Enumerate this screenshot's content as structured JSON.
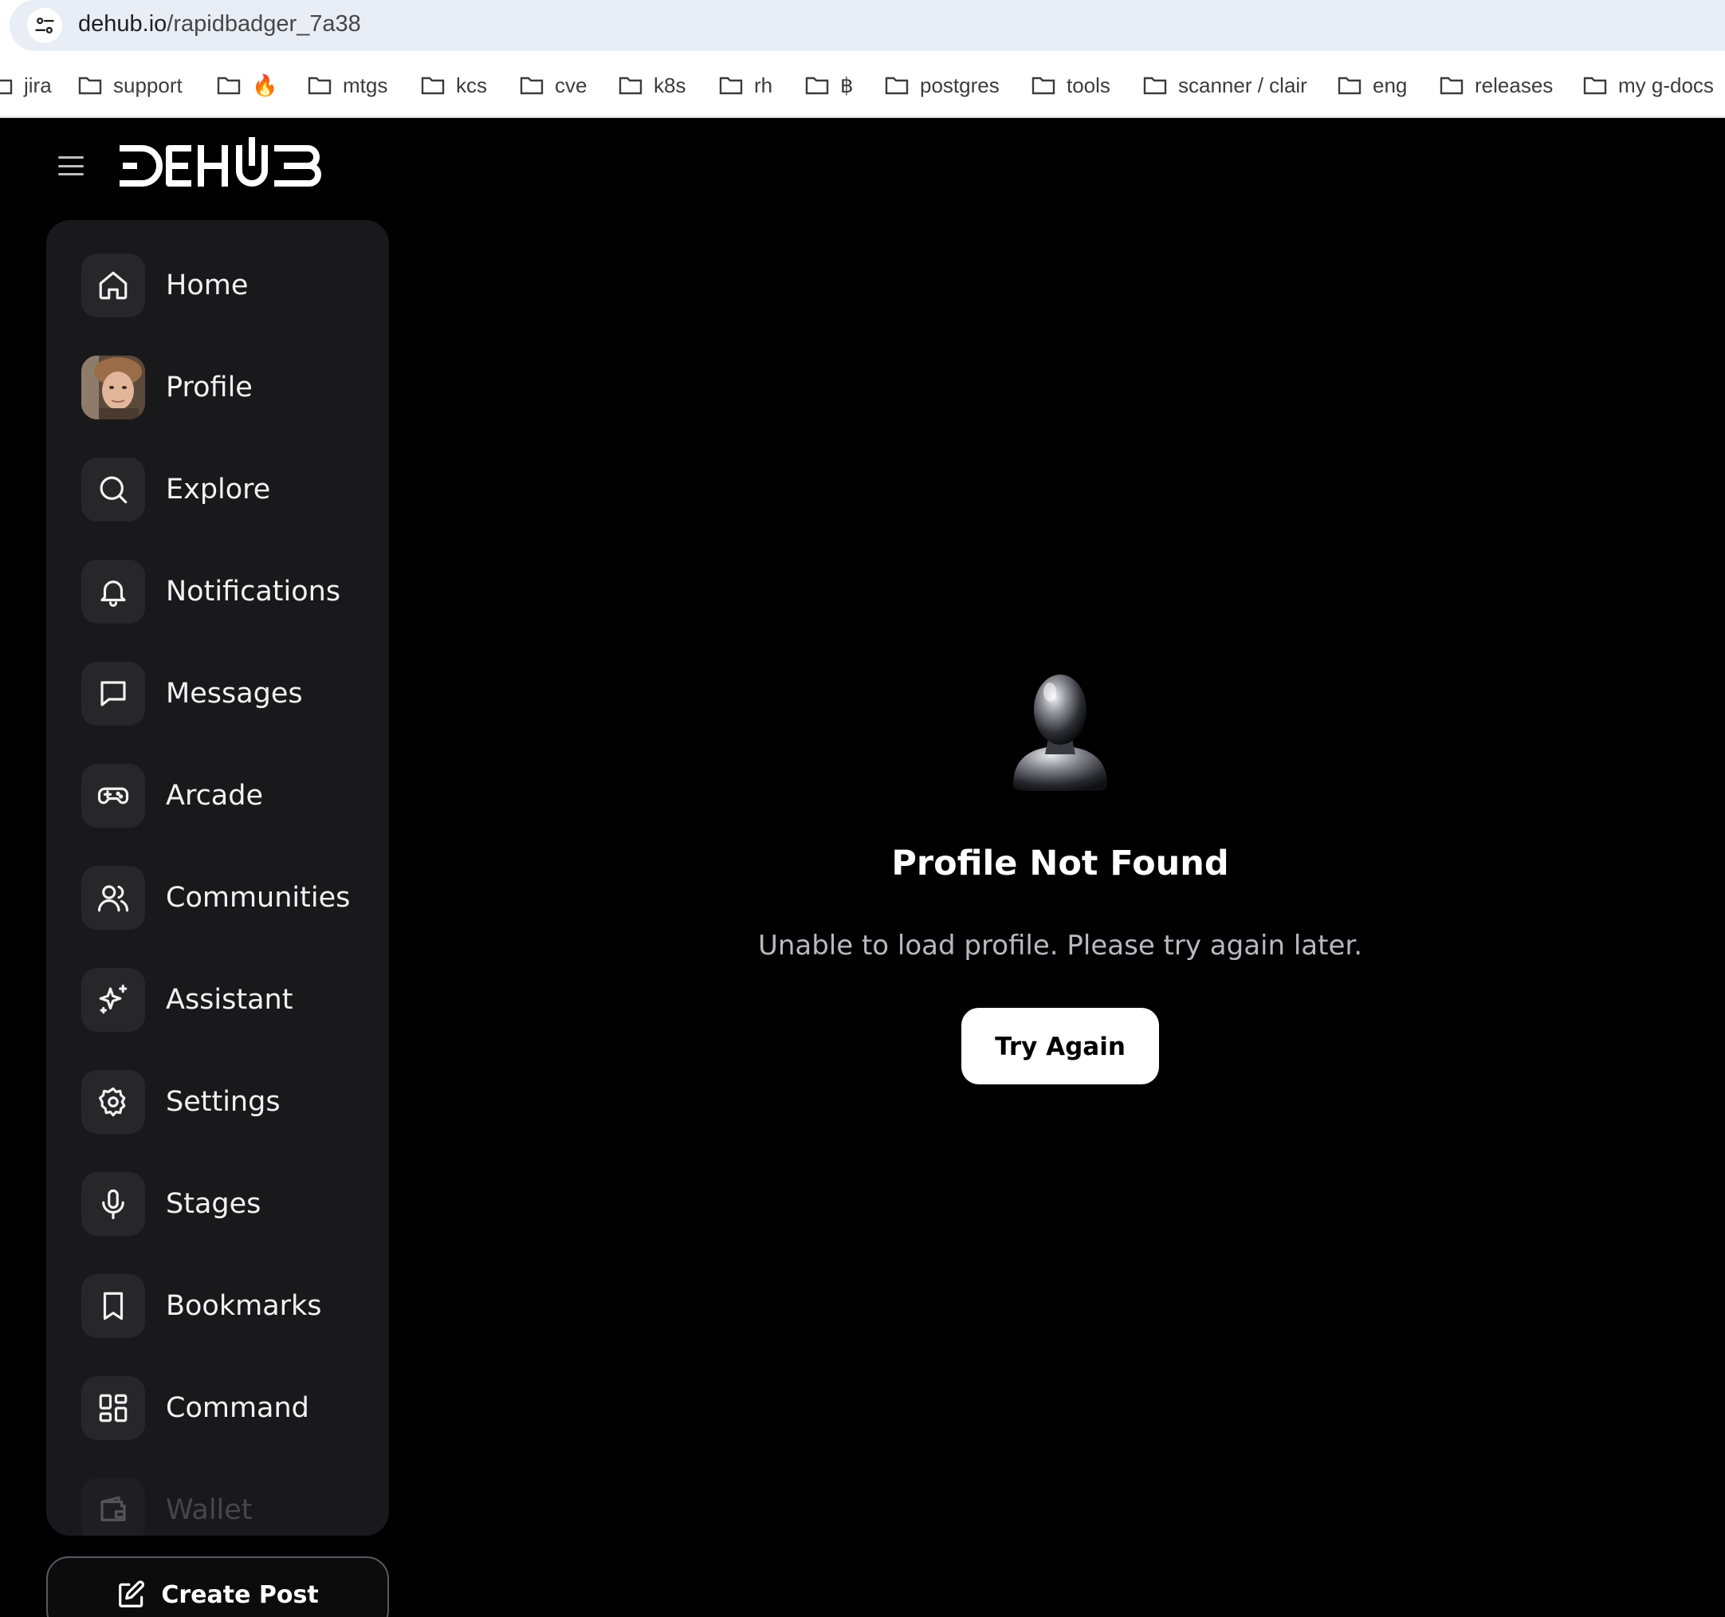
{
  "browser": {
    "url_host": "dehub.io",
    "url_path": "/rapidbadger_7a38",
    "site_info_icon": "tune-icon",
    "bookmarks": [
      {
        "label": "jira"
      },
      {
        "label": "support"
      },
      {
        "label": "🔥"
      },
      {
        "label": "mtgs"
      },
      {
        "label": "kcs"
      },
      {
        "label": "cve"
      },
      {
        "label": "k8s"
      },
      {
        "label": "rh"
      },
      {
        "label": "฿"
      },
      {
        "label": "postgres"
      },
      {
        "label": "tools"
      },
      {
        "label": "scanner / clair"
      },
      {
        "label": "eng"
      },
      {
        "label": "releases"
      },
      {
        "label": "my g-docs"
      }
    ]
  },
  "app": {
    "logo_text": "DEHUB",
    "menu_icon": "hamburger-menu-icon",
    "nav": [
      {
        "label": "Home",
        "icon": "home-icon"
      },
      {
        "label": "Profile",
        "icon": "avatar"
      },
      {
        "label": "Explore",
        "icon": "search-icon"
      },
      {
        "label": "Notifications",
        "icon": "bell-icon"
      },
      {
        "label": "Messages",
        "icon": "message-icon"
      },
      {
        "label": "Arcade",
        "icon": "gamepad-icon"
      },
      {
        "label": "Communities",
        "icon": "users-icon"
      },
      {
        "label": "Assistant",
        "icon": "sparkles-icon"
      },
      {
        "label": "Settings",
        "icon": "gear-icon"
      },
      {
        "label": "Stages",
        "icon": "microphone-icon"
      },
      {
        "label": "Bookmarks",
        "icon": "bookmark-icon"
      },
      {
        "label": "Command",
        "icon": "dashboard-icon"
      },
      {
        "label": "Wallet",
        "icon": "wallet-icon"
      }
    ],
    "create_post_label": "Create Post"
  },
  "main": {
    "empty_state": {
      "title": "Profile Not Found",
      "message": "Unable to load profile. Please try again later.",
      "button_label": "Try Again"
    }
  },
  "colors": {
    "background": "#000000",
    "sidebar": "#19191b",
    "icon_tile": "#27272a",
    "text": "#f2f2f2",
    "muted_text": "#b9b9bd",
    "button": "#ffffff"
  }
}
